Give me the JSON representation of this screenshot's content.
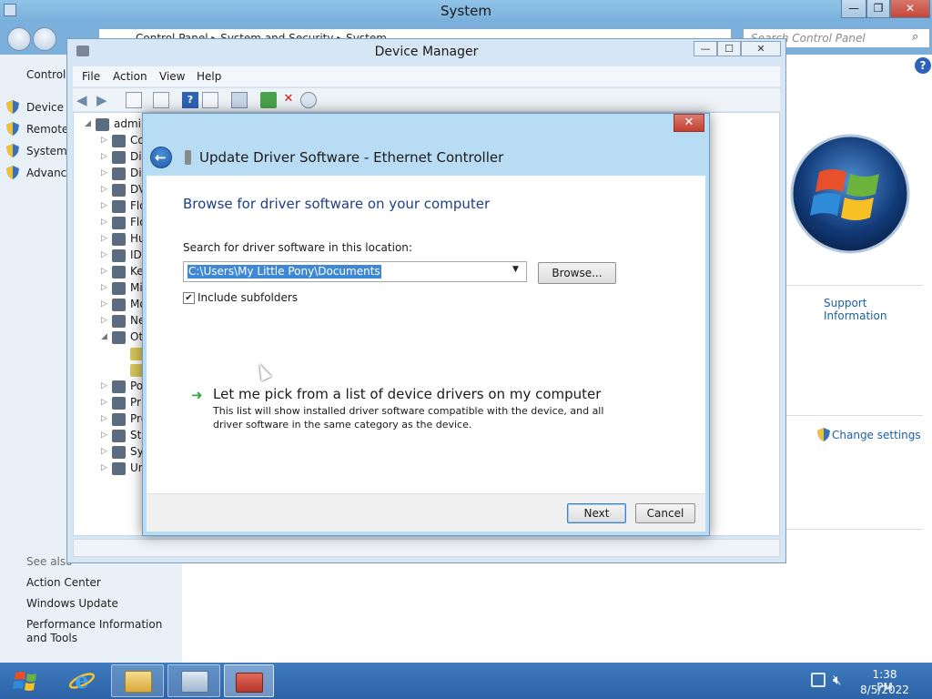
{
  "system_window": {
    "title": "System",
    "controls": {
      "minimize": "—",
      "maximize": "❐",
      "close": "✕"
    },
    "address": [
      "Control Panel",
      "System and Security",
      "System"
    ],
    "search_placeholder": "Search Control Panel",
    "sidebar": {
      "heading": "Control",
      "links": [
        "Device M",
        "Remote",
        "System p",
        "Advance"
      ],
      "see_also": "See also",
      "see_also_links": [
        "Action Center",
        "Windows Update",
        "Performance Information and Tools"
      ]
    },
    "support_information": "Support Information",
    "change_settings": "Change settings"
  },
  "device_manager": {
    "title": "Device Manager",
    "controls": {
      "minimize": "—",
      "maximize": "☐",
      "close": "✕"
    },
    "menu": [
      "File",
      "Action",
      "View",
      "Help"
    ],
    "tree": {
      "root": "admin",
      "items": [
        "Co",
        "Di",
        "Dis",
        "DV",
        "Flo",
        "Flo",
        "Hu",
        "IDI",
        "Ke",
        "Mi",
        "Mo",
        "Ne",
        "Ot",
        "",
        "",
        "Po",
        "Pri",
        "Pro",
        "Sto",
        "Sy",
        "Un"
      ]
    }
  },
  "dialog": {
    "title": "Update Driver Software - Ethernet Controller",
    "close": "✕",
    "heading": "Browse for driver software on your computer",
    "search_label": "Search for driver software in this location:",
    "path_value": "C:\\Users\\My Little Pony\\Documents",
    "browse_button": "Browse...",
    "include_subfolders": "Include subfolders",
    "include_subfolders_checked": true,
    "pick_title": "Let me pick from a list of device drivers on my computer",
    "pick_description": "This list will show installed driver software compatible with the device, and all driver software in the same category as the device.",
    "next_button": "Next",
    "cancel_button": "Cancel"
  },
  "taskbar": {
    "time": "1:38 PM",
    "date": "8/5/2022"
  }
}
